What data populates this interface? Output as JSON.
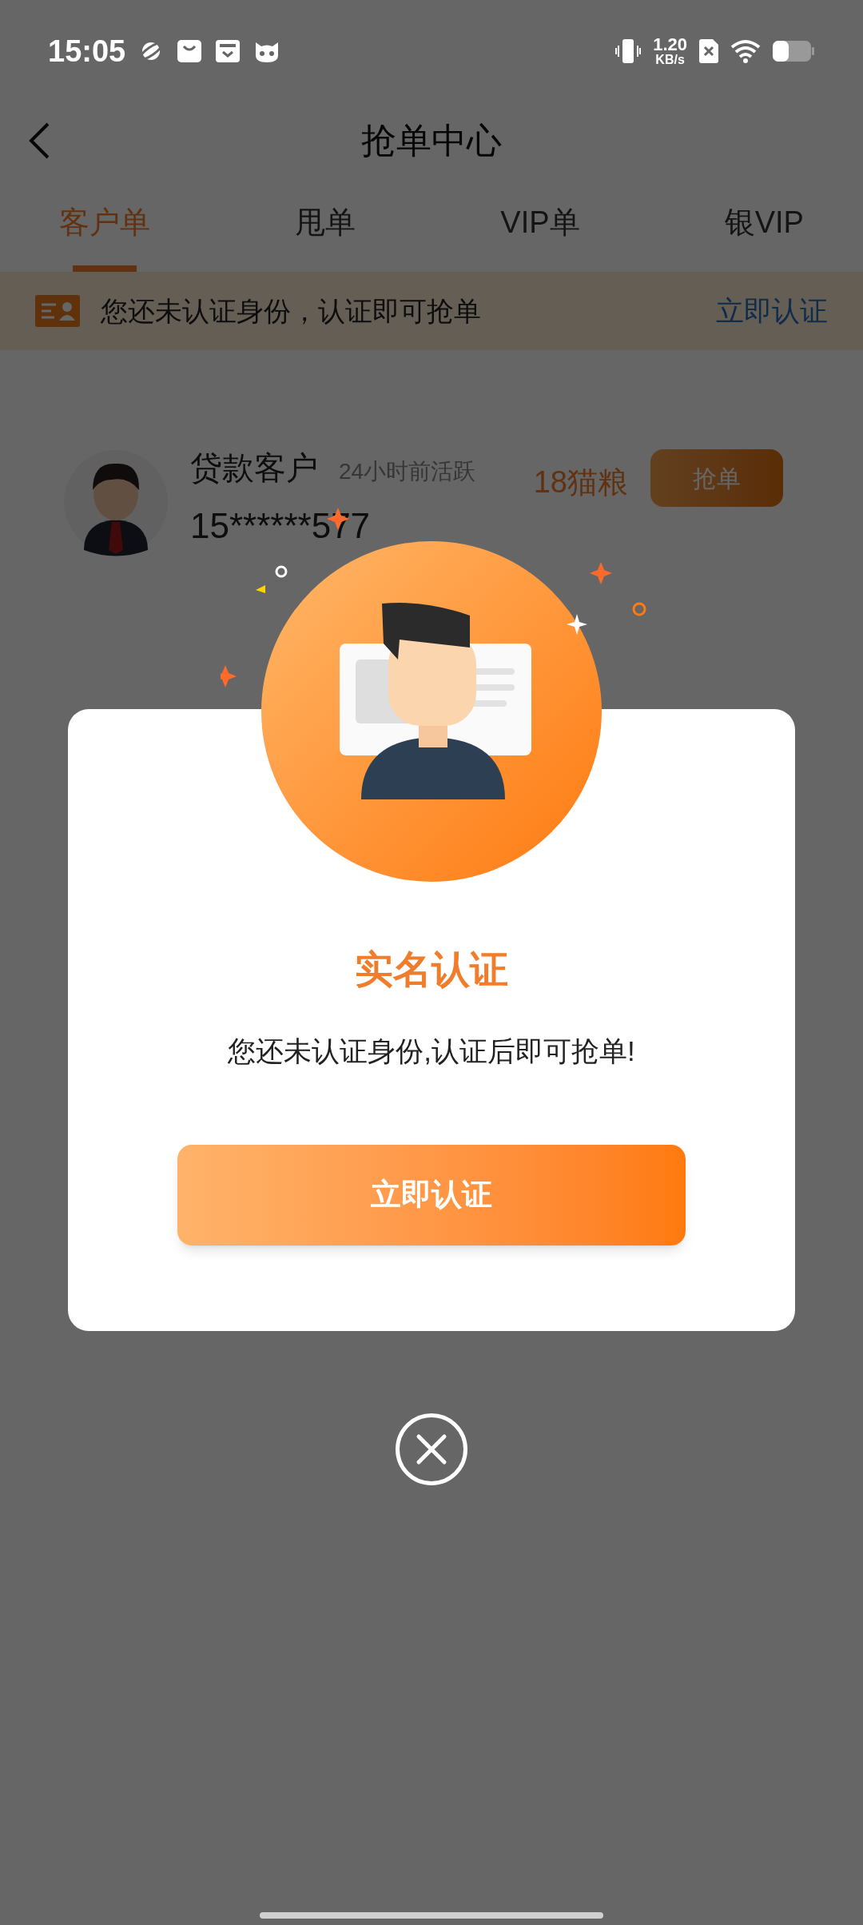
{
  "status_bar": {
    "time": "15:05",
    "speed_value": "1.20",
    "speed_unit": "KB/s"
  },
  "header": {
    "title": "抢单中心"
  },
  "tabs": [
    {
      "label": "客户单",
      "selected": true
    },
    {
      "label": "甩单",
      "selected": false
    },
    {
      "label": "VIP单",
      "selected": false
    },
    {
      "label": "银VIP",
      "selected": false
    }
  ],
  "banner": {
    "text": "您还未认证身份，认证即可抢单",
    "action": "立即认证"
  },
  "customers": [
    {
      "name": "贷款客户",
      "activity": "24小时前活跃",
      "phone": "15******577",
      "price": "18猫粮",
      "button": "抢单"
    }
  ],
  "dialog": {
    "title": "实名认证",
    "message": "您还未认证身份,认证后即可抢单!",
    "button": "立即认证"
  }
}
